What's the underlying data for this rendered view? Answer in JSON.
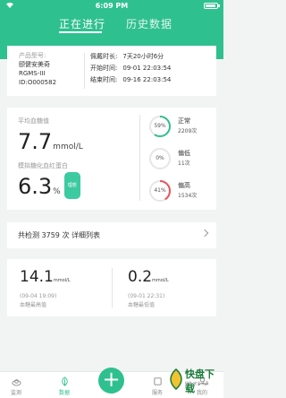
{
  "status_bar": {
    "time": "6:09 PM"
  },
  "tabs": {
    "active": "正在进行",
    "inactive": "历史数据"
  },
  "device": {
    "model_label": "产品型号:",
    "name": "颐健安美奇",
    "model": "RGMS-III",
    "id": "ID:O000582",
    "rows": [
      {
        "label": "佩戴时长:",
        "value": "7天20小时6分"
      },
      {
        "label": "开始时间:",
        "value": "09-01 22:03:54"
      },
      {
        "label": "结束时间:",
        "value": "09-16 22:03:54"
      }
    ]
  },
  "glucose": {
    "avg_label": "平均血糖值",
    "avg_value": "7.7",
    "avg_unit": "mmol/L",
    "hba_label": "模拟糖化血红蛋白",
    "hba_value": "6.3",
    "hba_unit": "%",
    "hba_tag": "理想",
    "rings": [
      {
        "percent_text": "59%",
        "percent": 59,
        "status": "正常",
        "count": "2209次",
        "color": "#2fc08f"
      },
      {
        "percent_text": "0%",
        "percent": 0,
        "status": "偏低",
        "count": "11次",
        "color": "#2fc08f"
      },
      {
        "percent_text": "41%",
        "percent": 41,
        "status": "偏高",
        "count": "1534次",
        "color": "#e8545a"
      }
    ]
  },
  "total": {
    "text": "共检测 3759 次 详细列表"
  },
  "extremes": {
    "max": {
      "value": "14.1",
      "unit": "mmol/L",
      "time": "(09-04 19:09)",
      "label": "血糖最高值"
    },
    "min": {
      "value": "0.2",
      "unit": "mmol/L",
      "time": "(09-01 22:31)",
      "label": "血糖最低值"
    }
  },
  "nav": {
    "items": [
      {
        "label": "监测"
      },
      {
        "label": "数据"
      },
      {
        "label": "服务"
      },
      {
        "label": "我的"
      }
    ],
    "fab": "+"
  },
  "watermark": {
    "text": "快盘下载",
    "sub": "绿色·安全·无毒"
  },
  "colors": {
    "accent": "#2fc08f",
    "high": "#e8545a"
  }
}
